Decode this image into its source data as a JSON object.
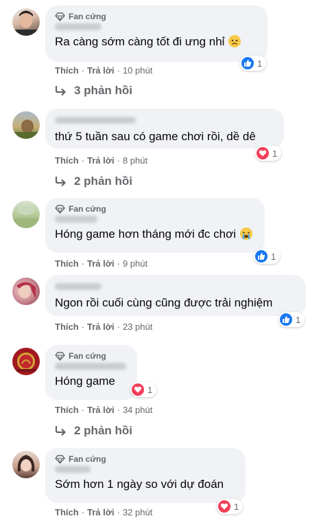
{
  "comments": [
    {
      "badge": "Fan cứng",
      "text": "Ra càng sớm càng tốt đi ưng nhỉ",
      "emoji": "sad-emoji",
      "like": "Thích",
      "reply": "Trả lời",
      "time": "10 phút",
      "reaction_type": "like",
      "reaction_count": "1",
      "replies": "3 phản hồi"
    },
    {
      "badge": "",
      "text": "thứ 5 tuần sau có game chơi rồi, dề dê",
      "like": "Thích",
      "reply": "Trả lời",
      "time": "8 phút",
      "reaction_type": "love",
      "reaction_count": "1",
      "replies": "2 phản hồi"
    },
    {
      "badge": "Fan cứng",
      "text": "Hóng game hơn tháng mới đc chơi",
      "emoji": "crying-emoji",
      "like": "Thích",
      "reply": "Trả lời",
      "time": "9 phút",
      "reaction_type": "like",
      "reaction_count": "1"
    },
    {
      "badge": "",
      "text": "Ngon rồi cuối cùng cũng được trải nghiệm",
      "like": "Thích",
      "reply": "Trả lời",
      "time": "23 phút",
      "reaction_type": "like",
      "reaction_count": "1"
    },
    {
      "badge": "Fan cứng",
      "text": "Hóng game",
      "like": "Thích",
      "reply": "Trả lời",
      "time": "34 phút",
      "reaction_type": "love",
      "reaction_count": "1",
      "replies": "2 phản hồi"
    },
    {
      "badge": "Fan cứng",
      "text": "Sớm hơn 1 ngày so với dự đoán",
      "like": "Thích",
      "reply": "Trả lời",
      "time": "32 phút",
      "reaction_type": "love",
      "reaction_count": "1"
    }
  ],
  "colors": {
    "like": "#1877f2",
    "love": "#f33e58",
    "bubble": "#f0f2f5",
    "meta": "#65676b"
  }
}
